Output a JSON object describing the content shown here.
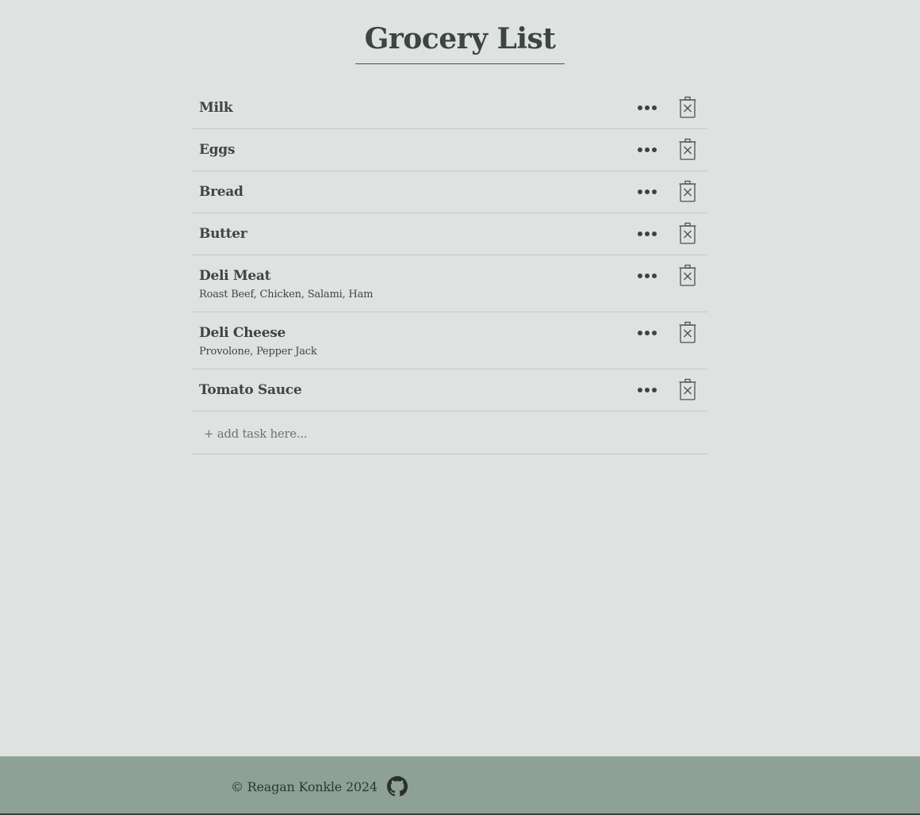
{
  "page": {
    "title": "Grocery List"
  },
  "items": [
    {
      "name": "Milk",
      "detail": ""
    },
    {
      "name": "Eggs",
      "detail": ""
    },
    {
      "name": "Bread",
      "detail": ""
    },
    {
      "name": "Butter",
      "detail": ""
    },
    {
      "name": "Deli Meat",
      "detail": "Roast Beef, Chicken, Salami, Ham"
    },
    {
      "name": "Deli Cheese",
      "detail": "Provolone, Pepper Jack"
    },
    {
      "name": "Tomato Sauce",
      "detail": ""
    }
  ],
  "add_task": {
    "placeholder": "+ add task here...",
    "value": ""
  },
  "footer": {
    "copyright": "© Reagan Konkle 2024",
    "icon": "github-icon"
  },
  "icons": {
    "more": "more-options-icon",
    "delete": "trash-icon"
  },
  "colors": {
    "background": "#dee3e1",
    "footer": "#8da196",
    "text": "#3b433d"
  }
}
